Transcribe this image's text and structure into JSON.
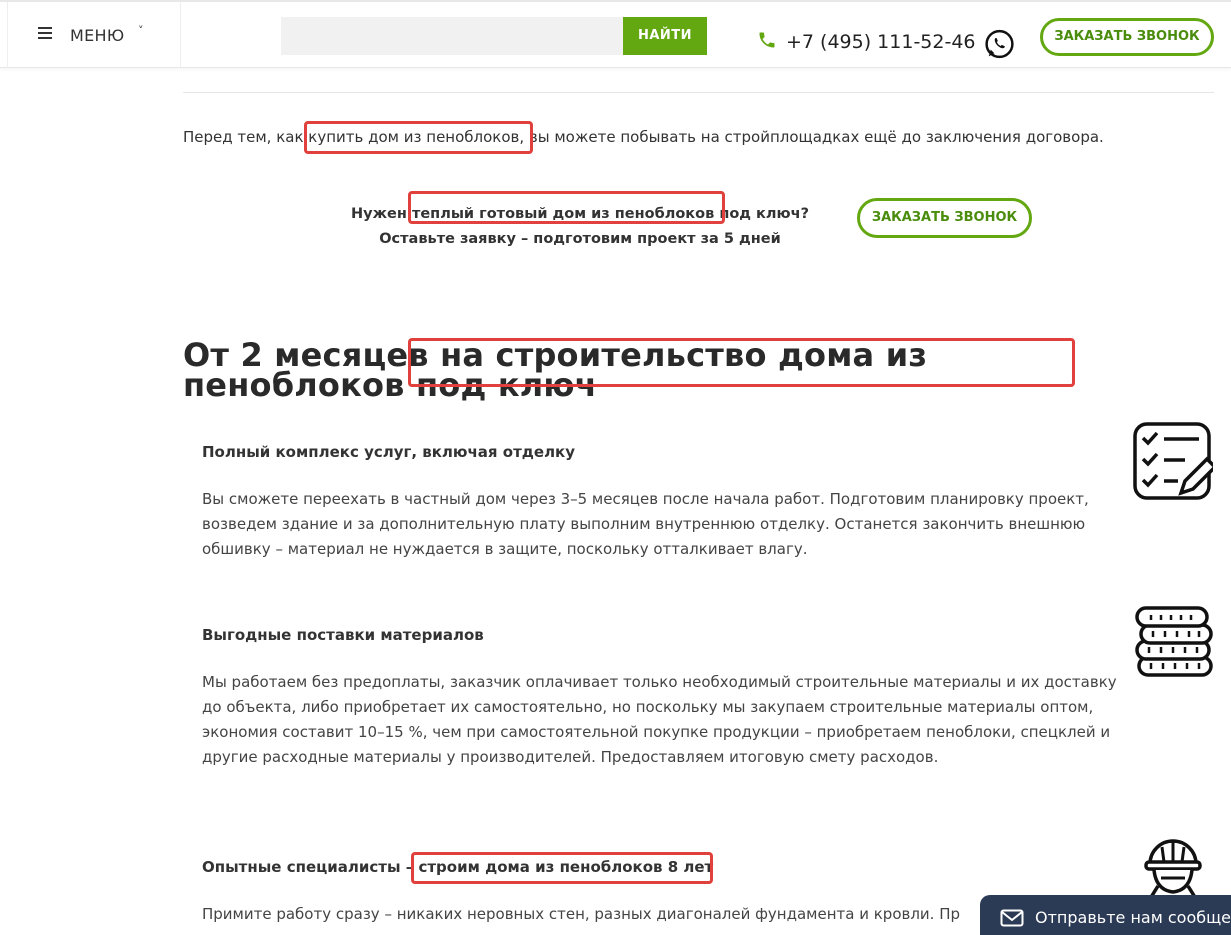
{
  "header": {
    "menu_label": "МЕНЮ",
    "search_button": "НАЙТИ",
    "search_placeholder": "",
    "phone": "+7 (495) 111-52-46",
    "callback_button": "ЗАКАЗАТЬ ЗВОНОК"
  },
  "intro": {
    "prefix": "Перед тем, как ",
    "highlight": "купить дом из пеноблоков",
    "suffix": ", вы можете побывать на стройплощадках ещё до заключения договора."
  },
  "cta": {
    "line1_prefix": "Нужен ",
    "line1_highlight": "теплый готовый дом из пеноблоков",
    "line1_suffix": " под ключ?",
    "line2": "Оставьте заявку – подготовим проект за 5 дней",
    "button": "ЗАКАЗАТЬ ЗВОНОК"
  },
  "heading": {
    "prefix": "От 2 месяцев ",
    "highlight": "на строительство дома из пеноблоков",
    "suffix": " под ключ"
  },
  "features": [
    {
      "title": "Полный комплекс услуг, включая отделку",
      "text": "Вы сможете переехать в частный дом через 3–5 месяцев после начала работ. Подготовим планировку проект, возведем здание и за дополнительную плату выполним внутреннюю отделку. Останется закончить внешнюю обшивку – материал не нуждается в защите, поскольку отталкивает влагу.",
      "icon": "checklist-icon"
    },
    {
      "title": "Выгодные поставки материалов",
      "text": "Мы работаем без предоплаты, заказчик оплачивает только необходимый строительные материалы и их доставку до объекта, либо приобретает их самостоятельно, но поскольку мы закупаем строительные материалы оптом, экономия составит 10–15 %, чем при самостоятельной покупке продукции – приобретаем пеноблоки, спецклей и другие расходные материалы у производителей. Предоставляем итоговую смету расходов.",
      "icon": "coins-icon"
    },
    {
      "title_prefix": "Опытные специалисты – ",
      "title_highlight": "строим дома из пеноблоков 8 лет",
      "text": "Примите работу сразу – никаких неровных стен, разных диагоналей фундамента и кровли. Пр",
      "icon": "worker-icon"
    }
  ],
  "chat": {
    "label": "Отправьте нам сообще"
  },
  "colors": {
    "accent_green": "#63a711",
    "highlight_red": "#e0413c",
    "chat_bg": "#2b3a55"
  }
}
